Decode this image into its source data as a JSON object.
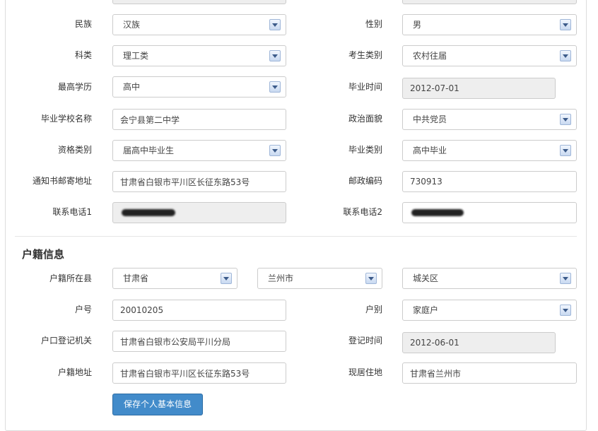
{
  "basic": {
    "ethnicity": {
      "label": "民族",
      "value": "汉族"
    },
    "gender": {
      "label": "性别",
      "value": "男"
    },
    "subject": {
      "label": "科类",
      "value": "理工类"
    },
    "candidate_type": {
      "label": "考生类别",
      "value": "农村往届"
    },
    "education": {
      "label": "最高学历",
      "value": "高中"
    },
    "graduation_time": {
      "label": "毕业时间",
      "value": "2012-07-01"
    },
    "school_name": {
      "label": "毕业学校名称",
      "value": "会宁县第二中学"
    },
    "political": {
      "label": "政治面貌",
      "value": "中共党员"
    },
    "qualification": {
      "label": "资格类别",
      "value": "届高中毕业生"
    },
    "graduation_type": {
      "label": "毕业类别",
      "value": "高中毕业"
    },
    "mail_address": {
      "label": "通知书邮寄地址",
      "value": "甘肃省白银市平川区长征东路53号"
    },
    "postcode": {
      "label": "邮政编码",
      "value": "730913"
    },
    "phone1": {
      "label": "联系电话1"
    },
    "phone2": {
      "label": "联系电话2"
    }
  },
  "household": {
    "title": "户籍信息",
    "county": {
      "label": "户籍所在县",
      "province": "甘肃省",
      "city": "兰州市",
      "district": "城关区"
    },
    "number": {
      "label": "户号",
      "value": "20010205"
    },
    "type": {
      "label": "户别",
      "value": "家庭户"
    },
    "authority": {
      "label": "户口登记机关",
      "value": "甘肃省白银市公安局平川分局"
    },
    "register_time": {
      "label": "登记时间",
      "value": "2012-06-01"
    },
    "address": {
      "label": "户籍地址",
      "value": "甘肃省白银市平川区长征东路53号"
    },
    "residence": {
      "label": "现居住地",
      "value": "甘肃省兰州市"
    }
  },
  "save_button": "保存个人基本信息"
}
